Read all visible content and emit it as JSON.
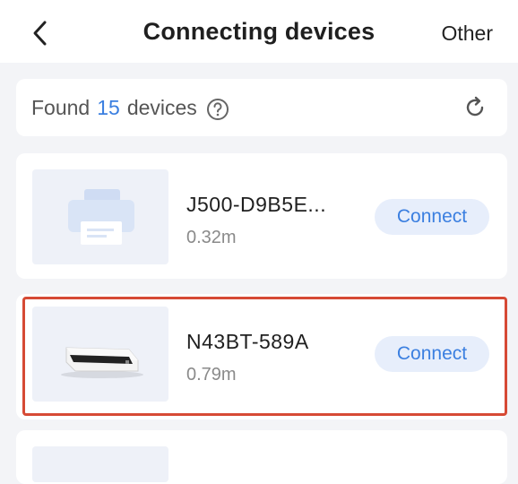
{
  "header": {
    "title": "Connecting devices",
    "other_label": "Other"
  },
  "found": {
    "prefix": "Found",
    "count": "15",
    "suffix": "devices"
  },
  "devices": [
    {
      "name": "J500-D9B5E...",
      "distance": "0.32m",
      "action": "Connect",
      "icon": "label-printer-icon"
    },
    {
      "name": "N43BT-589A",
      "distance": "0.79m",
      "action": "Connect",
      "icon": "thermal-printer-image"
    }
  ],
  "colors": {
    "accent": "#3b7fe0",
    "connect_bg": "#e7eefb",
    "highlight": "#d64a35",
    "background": "#f3f4f7"
  }
}
